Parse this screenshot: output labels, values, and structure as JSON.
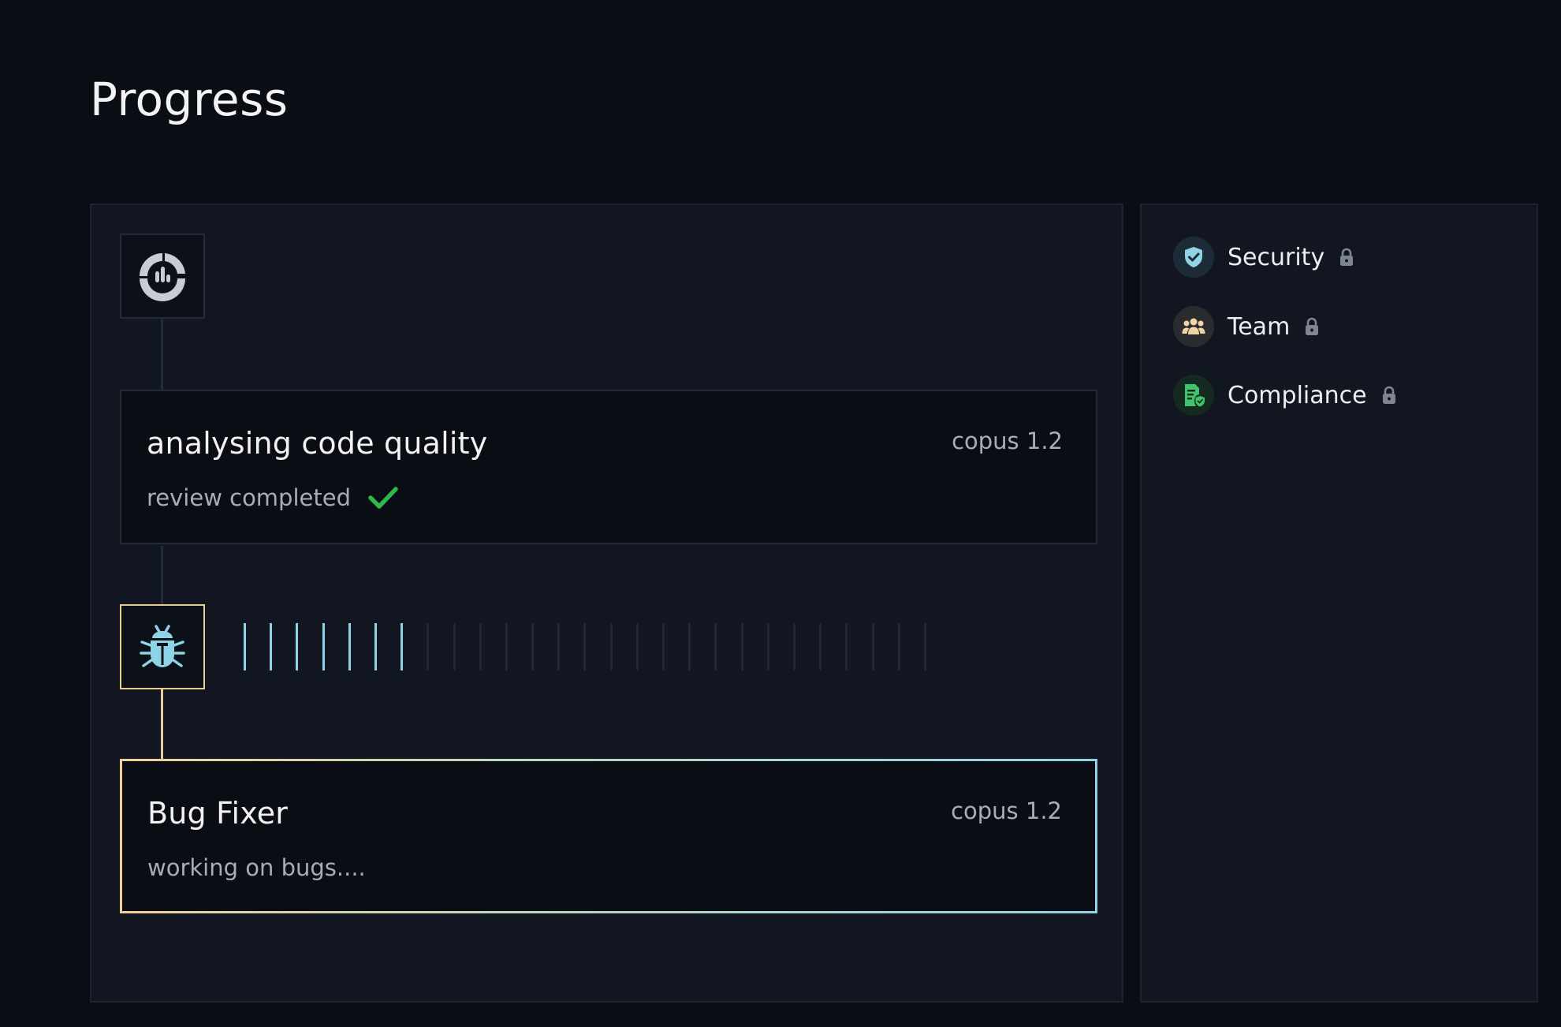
{
  "page": {
    "title": "Progress"
  },
  "timeline": {
    "steps": [
      {
        "title": "analysing code quality",
        "model": "copus 1.2",
        "status": "review completed",
        "state": "completed",
        "icon": "analytics-icon"
      },
      {
        "title": "Bug Fixer",
        "model": "copus 1.2",
        "status": "working on bugs....",
        "state": "in-progress",
        "icon": "bug-icon",
        "progress": {
          "filled": 7,
          "total": 27
        }
      }
    ]
  },
  "side_panel": {
    "items": [
      {
        "label": "Security",
        "icon": "shield-check-icon",
        "locked": true
      },
      {
        "label": "Team",
        "icon": "team-icon",
        "locked": true
      },
      {
        "label": "Compliance",
        "icon": "compliance-document-icon",
        "locked": true
      }
    ]
  },
  "colors": {
    "background": "#0a0d13",
    "panel": "#111620",
    "accent_cyan": "#8ed3e6",
    "accent_gold": "#e9cc95",
    "success_green": "#2fb84a"
  }
}
